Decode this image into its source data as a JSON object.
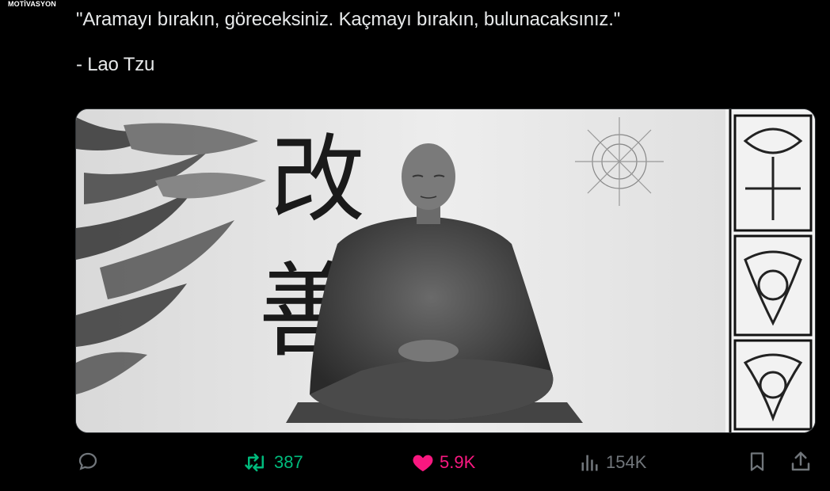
{
  "account": {
    "name": "MOTİVASYON"
  },
  "tweet": {
    "quote": "\"Aramayı bırakın, göreceksiniz. Kaçmayı bırakın, bulunacaksınız.\"",
    "author": "- Lao Tzu"
  },
  "media": {
    "calligraphy_top": "改",
    "calligraphy_bottom": "善"
  },
  "actions": {
    "reply_count": "",
    "retweet_count": "387",
    "like_count": "5.9K",
    "views_count": "154K"
  },
  "colors": {
    "retweet": "#00ba7c",
    "like": "#f91880",
    "muted": "#71767b"
  },
  "icons": [
    "reply-icon",
    "retweet-icon",
    "like-icon",
    "views-icon",
    "bookmark-icon",
    "share-icon"
  ]
}
